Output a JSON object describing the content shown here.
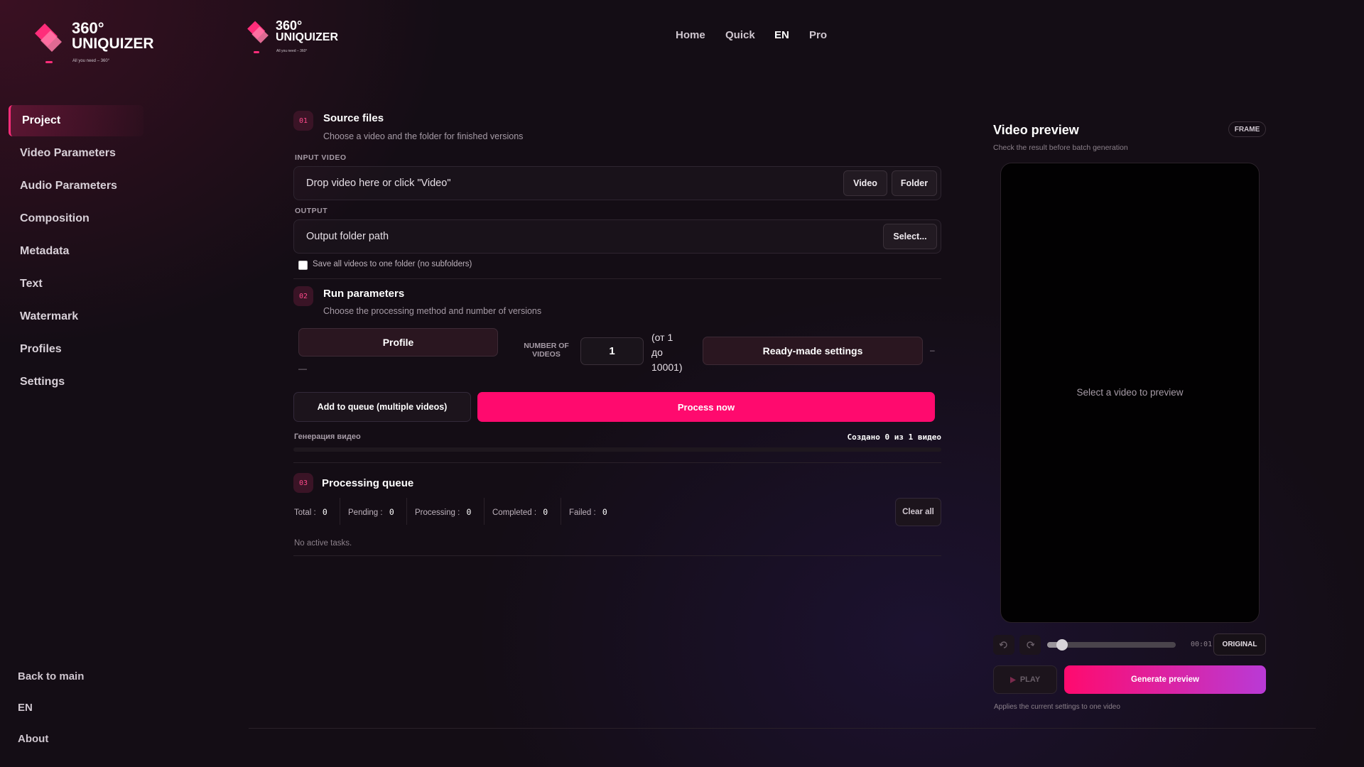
{
  "brand": {
    "name_line1": "360°",
    "name_line2": "UNIQUIZER",
    "tagline": "All you need – 360°",
    "accent": "#ff2d7a"
  },
  "nav": {
    "items": [
      "Home",
      "Quick",
      "EN",
      "Pro"
    ],
    "active": "EN"
  },
  "sidebar": {
    "items": [
      {
        "label": "Project",
        "active": true
      },
      {
        "label": "Video Parameters"
      },
      {
        "label": "Audio Parameters"
      },
      {
        "label": "Composition"
      },
      {
        "label": "Metadata"
      },
      {
        "label": "Text"
      },
      {
        "label": "Watermark"
      },
      {
        "label": "Profiles"
      },
      {
        "label": "Settings"
      }
    ],
    "bottom": [
      "Back to main",
      "EN",
      "About"
    ]
  },
  "source": {
    "num": "01",
    "title": "Source files",
    "subtitle": "Choose a video and the folder for finished versions",
    "input_label": "INPUT VIDEO",
    "input_placeholder": "Drop video here or click \"Video\"",
    "video_btn": "Video",
    "folder_btn": "Folder",
    "output_label": "OUTPUT",
    "output_placeholder": "Output folder path",
    "select_btn": "Select...",
    "checkbox_label": "Save all videos to one folder (no subfolders)"
  },
  "run": {
    "num": "02",
    "title": "Run parameters",
    "subtitle": "Choose the processing method and number of versions",
    "profile_btn": "Profile",
    "profile_dash": "—",
    "count_label_1": "NUMBER OF",
    "count_label_2": "VIDEOS",
    "count_value": "1",
    "range_1": "(от 1",
    "range_2": "до",
    "range_3": "10001)",
    "ready_btn": "Ready-made settings",
    "ready_dash": "–",
    "queue_btn": "Add to queue (multiple videos)",
    "process_btn": "Process now",
    "progress_label": "Генерация видео",
    "progress_status": "Создано 0 из 1 видео"
  },
  "queue": {
    "num": "03",
    "title": "Processing queue",
    "stats": [
      {
        "label": "Total",
        "value": "0"
      },
      {
        "label": "Pending",
        "value": "0"
      },
      {
        "label": "Processing",
        "value": "0"
      },
      {
        "label": "Completed",
        "value": "0"
      },
      {
        "label": "Failed",
        "value": "0"
      }
    ],
    "clear_btn": "Clear all",
    "empty_text": "No active tasks."
  },
  "preview": {
    "title": "Video preview",
    "frame_badge": "FRAME",
    "subtitle": "Check the result before batch generation",
    "empty_text": "Select a video to preview",
    "time": "00:01",
    "mode_btn": "ORIGINAL",
    "play_btn": "PLAY",
    "generate_btn": "Generate preview",
    "footnote": "Applies the current settings to one video"
  }
}
